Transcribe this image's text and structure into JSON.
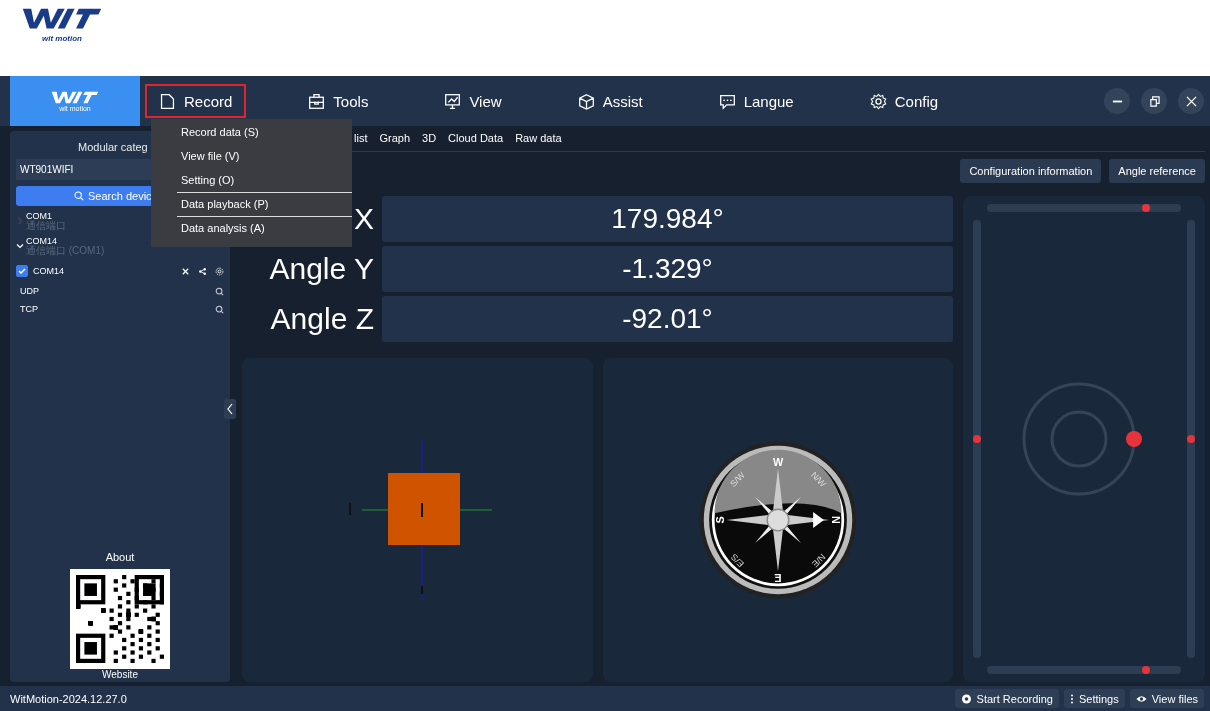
{
  "brand": {
    "logo_text": "wit motion"
  },
  "app": {
    "logo_text": "wit motion"
  },
  "menu": [
    {
      "label": "Record",
      "selected": true
    },
    {
      "label": "Tools",
      "selected": false
    },
    {
      "label": "View",
      "selected": false
    },
    {
      "label": "Assist",
      "selected": false
    },
    {
      "label": "Langue",
      "selected": false
    },
    {
      "label": "Config",
      "selected": false
    }
  ],
  "record_dropdown": [
    {
      "label": "Record data (S)",
      "separator_after": false
    },
    {
      "label": "View file (V)",
      "separator_after": false
    },
    {
      "label": "Setting (O)",
      "separator_after": true
    },
    {
      "label": "Data playback (P)",
      "separator_after": true
    },
    {
      "label": "Data analysis (A)",
      "separator_after": false
    }
  ],
  "sidebar": {
    "heading": "Modular categ",
    "model": "WT901WIFI",
    "search_button": "Search devic",
    "devices": [
      {
        "kind": "port",
        "name": "COM1",
        "subtitle": "通信端口",
        "expanded": false
      },
      {
        "kind": "port",
        "name": "COM14",
        "subtitle": "通信端口 (COM1)",
        "expanded": true,
        "children": [
          {
            "name": "COM14",
            "checked": true
          }
        ]
      },
      {
        "kind": "network",
        "name": "UDP"
      },
      {
        "kind": "network",
        "name": "TCP"
      }
    ],
    "about": "About",
    "qr_caption": "Website"
  },
  "tabs": [
    {
      "label": "list",
      "selected": false
    },
    {
      "label": "Graph",
      "selected": false
    },
    {
      "label": "3D",
      "selected": false
    },
    {
      "label": "Cloud Data",
      "selected": false
    },
    {
      "label": "Raw data",
      "selected": false
    }
  ],
  "buttons": [
    "Configuration information",
    "Angle reference"
  ],
  "angles": [
    {
      "label": "X",
      "value": "179.984°"
    },
    {
      "label": "Angle Y",
      "value": "-1.329°"
    },
    {
      "label": "Angle Z",
      "value": "-92.01°"
    }
  ],
  "compass": {
    "labels": [
      "W",
      "N/W",
      "N",
      "N/E",
      "E",
      "E/S",
      "S",
      "S/W"
    ]
  },
  "level_panel": {
    "top": {
      "level": 0.82
    },
    "bottom": {
      "level": 0.82
    },
    "left": {
      "level": 0.5
    },
    "right": {
      "level": 0.5
    }
  },
  "status_bar": {
    "version": "WitMotion-2024.12.27.0",
    "actions": [
      {
        "label": "Start Recording"
      },
      {
        "label": "Settings"
      },
      {
        "label": "View files"
      }
    ]
  }
}
